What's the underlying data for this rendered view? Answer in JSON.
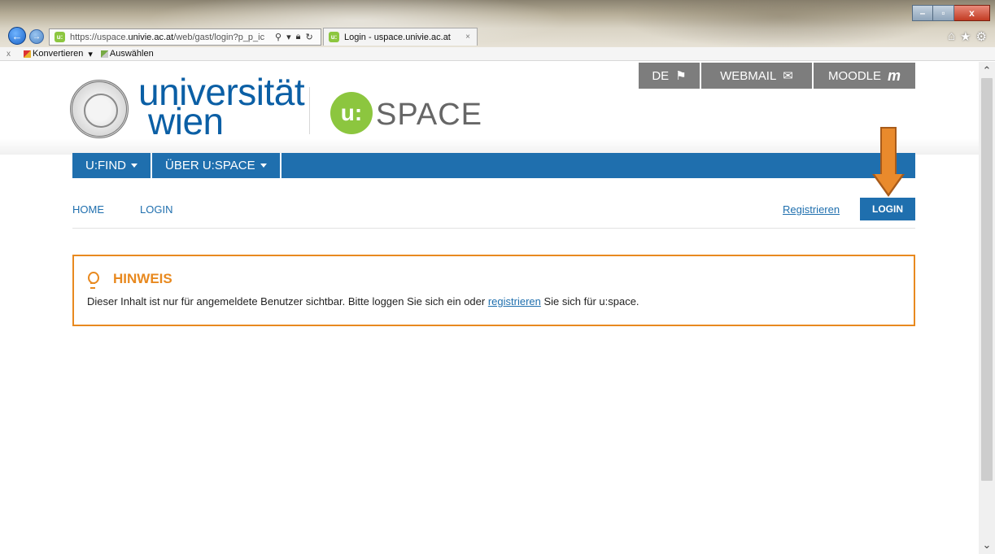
{
  "browser": {
    "url_prefix": "https://uspace.",
    "url_domain": "univie.ac.at",
    "url_rest": "/web/gast/login?p_p_ic",
    "tab_title": "Login - uspace.univie.ac.at",
    "tab_close": "×",
    "favicon": "u:",
    "cmdbar_close": "x",
    "cmdbar_items": [
      "Konvertieren",
      "Auswählen"
    ],
    "cmdbar_dropdown": "▾",
    "window_controls": {
      "minimize": "–",
      "maximize": "▫",
      "close": "x"
    },
    "icons": [
      "home-icon",
      "favorites-star-icon",
      "settings-gear-icon"
    ]
  },
  "header": {
    "university_line1": "universität",
    "university_line2": "wien",
    "uspace_mark": "u:",
    "uspace_text": "SPACE",
    "topnav": {
      "de": "DE",
      "webmail": "WEBMAIL",
      "moodle": "MOODLE",
      "moodle_glyph": "m"
    }
  },
  "mainnav": {
    "items": [
      "U:FIND",
      "ÜBER U:SPACE"
    ]
  },
  "breadcrumbs": {
    "home": "HOME",
    "login": "LOGIN"
  },
  "actions": {
    "register": "Registrieren",
    "login": "LOGIN"
  },
  "notice": {
    "title": "HINWEIS",
    "text_before": "Dieser Inhalt ist nur für angemeldete Benutzer sichtbar. Bitte loggen Sie sich ein oder ",
    "link": "registrieren",
    "text_after": " Sie sich für u:space."
  },
  "colors": {
    "brand_blue": "#1f6fae",
    "accent_orange": "#e8891f",
    "uspace_green": "#8cc63f",
    "topnav_gray": "#7d7d7d"
  }
}
